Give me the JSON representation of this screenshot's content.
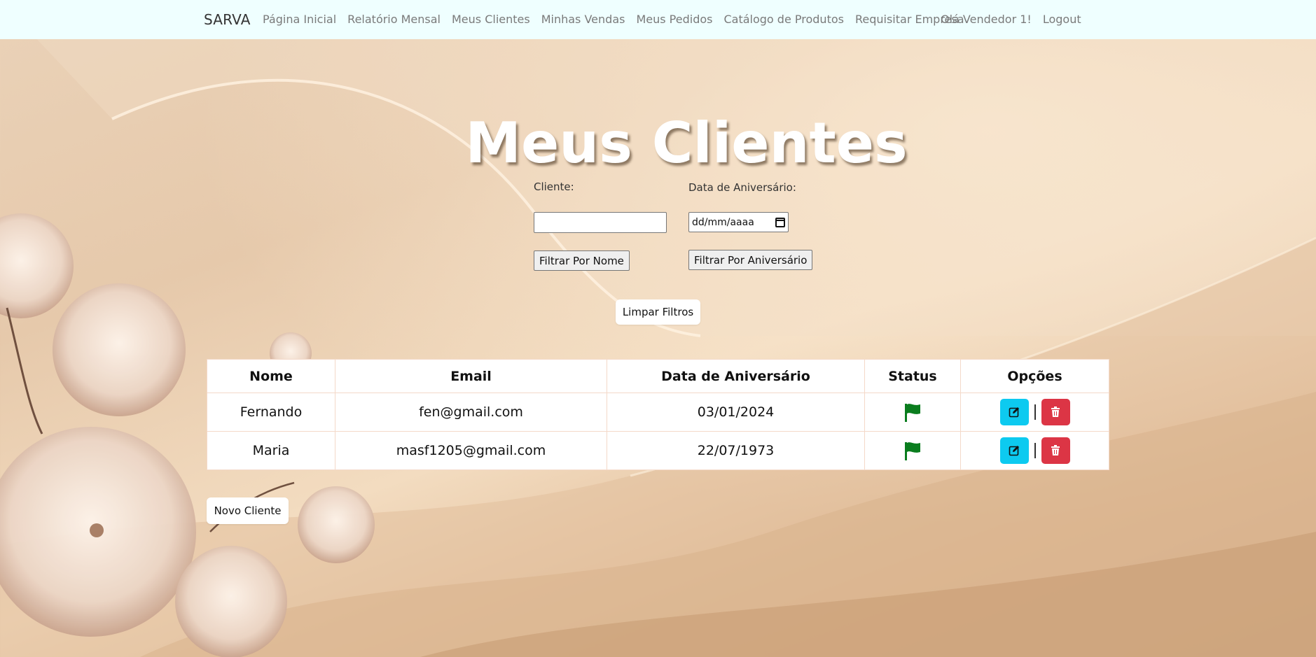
{
  "navbar": {
    "brand": "SARVA",
    "links": [
      "Página Inicial",
      "Relatório Mensal",
      "Meus Clientes",
      "Minhas Vendas",
      "Meus Pedidos",
      "Catálogo de Produtos",
      "Requisitar Empresa"
    ],
    "greeting": "Olá Vendedor 1!",
    "logout": "Logout"
  },
  "page": {
    "title": "Meus Clientes"
  },
  "filters": {
    "client_label": "Cliente:",
    "client_value": "",
    "birthday_label": "Data de Aniversário:",
    "birthday_placeholder": "dd/mm/aaaa",
    "filter_name_button": "Filtrar Por Nome",
    "filter_birthday_button": "Filtrar Por Aniversário",
    "clear_button": "Limpar Filtros"
  },
  "table": {
    "headers": [
      "Nome",
      "Email",
      "Data de Aniversário",
      "Status",
      "Opções"
    ],
    "rows": [
      {
        "nome": "Fernando",
        "email": "fen@gmail.com",
        "aniversario": "03/01/2024",
        "status_icon": "green-flag-icon"
      },
      {
        "nome": "Maria",
        "email": "masf1205@gmail.com",
        "aniversario": "22/07/1973",
        "status_icon": "green-flag-icon"
      }
    ],
    "separator": "|"
  },
  "actions": {
    "new_client_button": "Novo Cliente"
  },
  "colors": {
    "navbar_bg": "#efffff",
    "edit_btn": "#0dcaf0",
    "delete_btn": "#dc3545",
    "flag": "#0a7d1e"
  }
}
